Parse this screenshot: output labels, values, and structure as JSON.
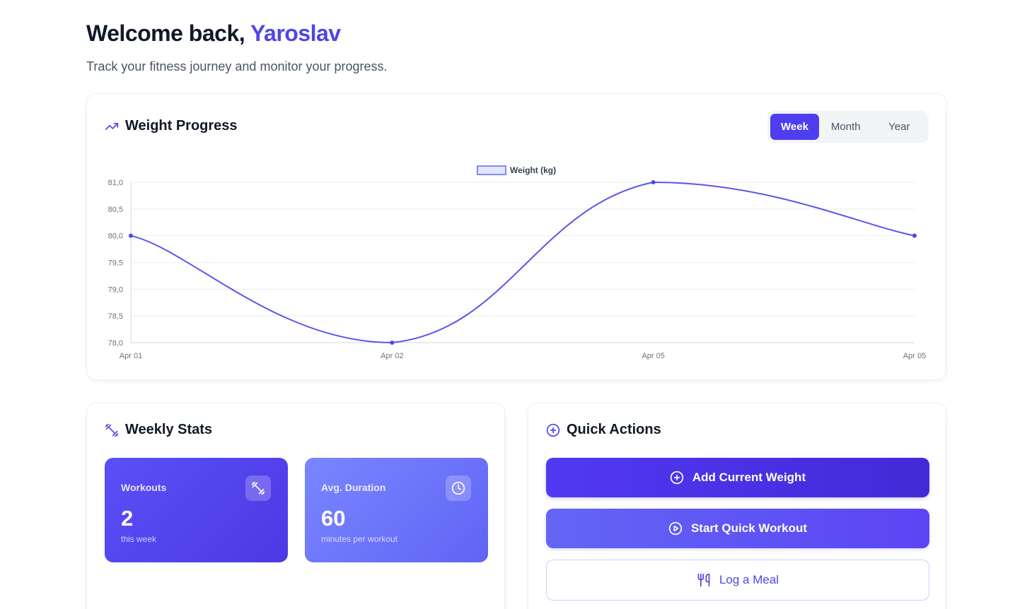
{
  "header": {
    "greeting": "Welcome back, ",
    "user_name": "Yaroslav",
    "subtitle": "Track your fitness journey and monitor your progress."
  },
  "weight_progress": {
    "title": "Weight Progress",
    "icon": "trending-up-icon",
    "periods": [
      "Week",
      "Month",
      "Year"
    ],
    "selected_period": "Week"
  },
  "chart_data": {
    "type": "line",
    "legend": "Weight (kg)",
    "legend_position": "top-center",
    "x": [
      "Apr 01",
      "Apr 02",
      "Apr 05",
      "Apr 05"
    ],
    "series": [
      {
        "name": "Weight (kg)",
        "values": [
          80.0,
          78.0,
          81.0,
          80.0
        ]
      }
    ],
    "ylim": [
      78.0,
      81.0
    ],
    "yticks": [
      "81,0",
      "80,5",
      "80,0",
      "79,5",
      "79,0",
      "78,5",
      "78,0"
    ],
    "grid": true,
    "color": "#6366f1"
  },
  "weekly_stats": {
    "title": "Weekly Stats",
    "icon": "dumbbell-icon",
    "cards": [
      {
        "label": "Workouts",
        "value": "2",
        "sub": "this week",
        "icon": "dumbbell-icon"
      },
      {
        "label": "Avg. Duration",
        "value": "60",
        "sub": "minutes per workout",
        "icon": "clock-icon"
      }
    ]
  },
  "quick_actions": {
    "title": "Quick Actions",
    "icon": "plus-circle-icon",
    "actions": [
      {
        "label": "Add Current Weight",
        "icon": "plus-circle-icon"
      },
      {
        "label": "Start Quick Workout",
        "icon": "play-circle-icon"
      },
      {
        "label": "Log a Meal",
        "icon": "utensils-icon"
      }
    ]
  },
  "colors": {
    "accent": "#4f46e5",
    "accent_dark": "#4429d8",
    "text": "#111827",
    "muted": "#4b5563"
  }
}
